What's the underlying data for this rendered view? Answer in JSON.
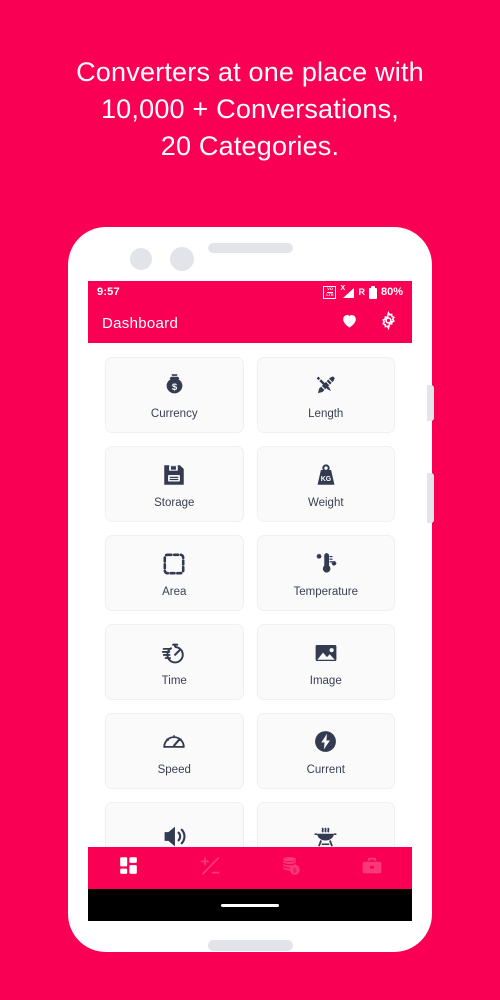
{
  "promo": {
    "lines": [
      "Converters at one place with",
      "10,000 + Conversations,",
      "20 Categories."
    ],
    "background_color": "#FA0055",
    "text_color": "#FFFFFF"
  },
  "device": {
    "frame_color": "#FFFFFF",
    "accent_color": "#E2E4EA",
    "camera_icon": "camera-dot",
    "speaker_icon": "speaker-slot",
    "volume_button": "volume-rocker",
    "power_button": "power-button"
  },
  "status_bar": {
    "time": "9:57",
    "volte_top": "VO",
    "volte_bottom": "LTE",
    "signal_icon": "signal-bars-no-service",
    "signal_x": "X",
    "roaming": "R",
    "battery_icon": "battery-icon",
    "battery_level": "80%",
    "background_color": "#FA0055"
  },
  "app_bar": {
    "title": "Dashboard",
    "actions": [
      {
        "name": "favorites",
        "icon": "heart-icon"
      },
      {
        "name": "settings",
        "icon": "gear-icon"
      }
    ],
    "background_color": "#FA0055"
  },
  "dashboard": {
    "tiles": [
      {
        "label": "Currency",
        "icon": "money-bag-icon"
      },
      {
        "label": "Length",
        "icon": "ruler-pencil-icon"
      },
      {
        "label": "Storage",
        "icon": "floppy-disk-icon"
      },
      {
        "label": "Weight",
        "icon": "kg-weight-icon"
      },
      {
        "label": "Area",
        "icon": "dashed-square-icon"
      },
      {
        "label": "Temperature",
        "icon": "thermometer-icon"
      },
      {
        "label": "Time",
        "icon": "stopwatch-icon"
      },
      {
        "label": "Image",
        "icon": "picture-icon"
      },
      {
        "label": "Speed",
        "icon": "speedometer-icon"
      },
      {
        "label": "Current",
        "icon": "lightning-bolt-icon"
      },
      {
        "label": "",
        "icon": "speaker-volume-icon"
      },
      {
        "label": "",
        "icon": "bbq-grill-icon"
      }
    ],
    "tile_background": "#FAFAFB",
    "tile_icon_color": "#343A4F"
  },
  "bottom_nav": {
    "items": [
      {
        "name": "dashboard",
        "icon": "grid-squares-icon",
        "active": true
      },
      {
        "name": "calculator",
        "icon": "plus-minus-icon",
        "active": false
      },
      {
        "name": "finance",
        "icon": "coins-stack-icon",
        "active": false
      },
      {
        "name": "tools",
        "icon": "briefcase-icon",
        "active": false
      }
    ],
    "active_color": "#FFFFFF",
    "inactive_color": "#F9387A",
    "background_color": "#FA0055"
  },
  "system_nav": {
    "gesture_pill": "home-gesture-pill",
    "background_color": "#000000"
  }
}
